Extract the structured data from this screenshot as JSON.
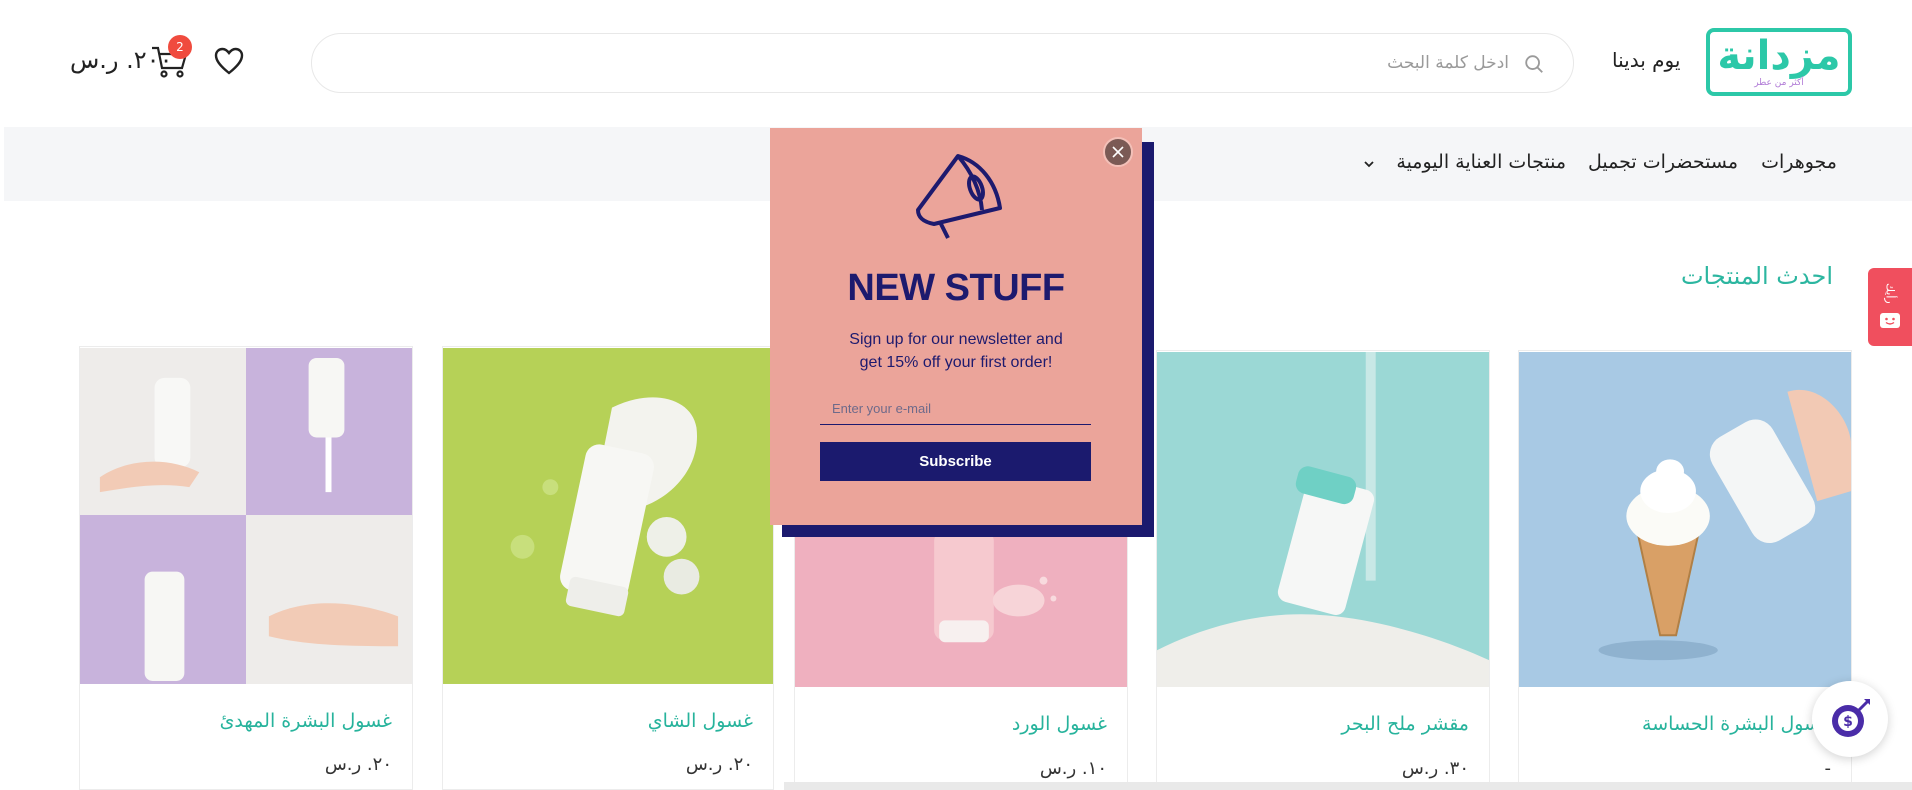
{
  "header": {
    "logo_text": "مزدانة",
    "logo_tagline": "أكثر من عطر",
    "brand_text": "يوم بدينا",
    "search": {
      "placeholder": "ادخل كلمة البحث"
    },
    "cart": {
      "count": "2",
      "total": "٢٠٠. ر.س"
    }
  },
  "nav": {
    "items": [
      {
        "label": "مجوهرات"
      },
      {
        "label": "مستحضرات تجميل"
      },
      {
        "label": "منتجات العناية اليومية"
      }
    ]
  },
  "section": {
    "title": "احدث المنتجات"
  },
  "products": [
    {
      "name": "غسول البشرة الحساسة",
      "price": "-"
    },
    {
      "name": "مقشر ملح البحر",
      "price": "٣٠. ر.س"
    },
    {
      "name": "غسول الورد",
      "price": "١٠. ر.س"
    },
    {
      "name": "غسول الشاي",
      "price": "٢٠. ر.س"
    },
    {
      "name": "غسول البشرة المهدئ",
      "price": "٢٠. ر.س"
    }
  ],
  "side_tab": {
    "label": "رأيك"
  },
  "popup": {
    "title": "NEW STUFF",
    "text_line1": "Sign up for our newsletter and",
    "text_line2": "get 15% off your first order!",
    "email_placeholder": "Enter your e-mail",
    "button_label": "Subscribe"
  },
  "colors": {
    "accent": "#2cc8a8",
    "popup_bg": "#eba49a",
    "popup_navy": "#1b1a6e",
    "badge_red": "#f04b3e"
  }
}
